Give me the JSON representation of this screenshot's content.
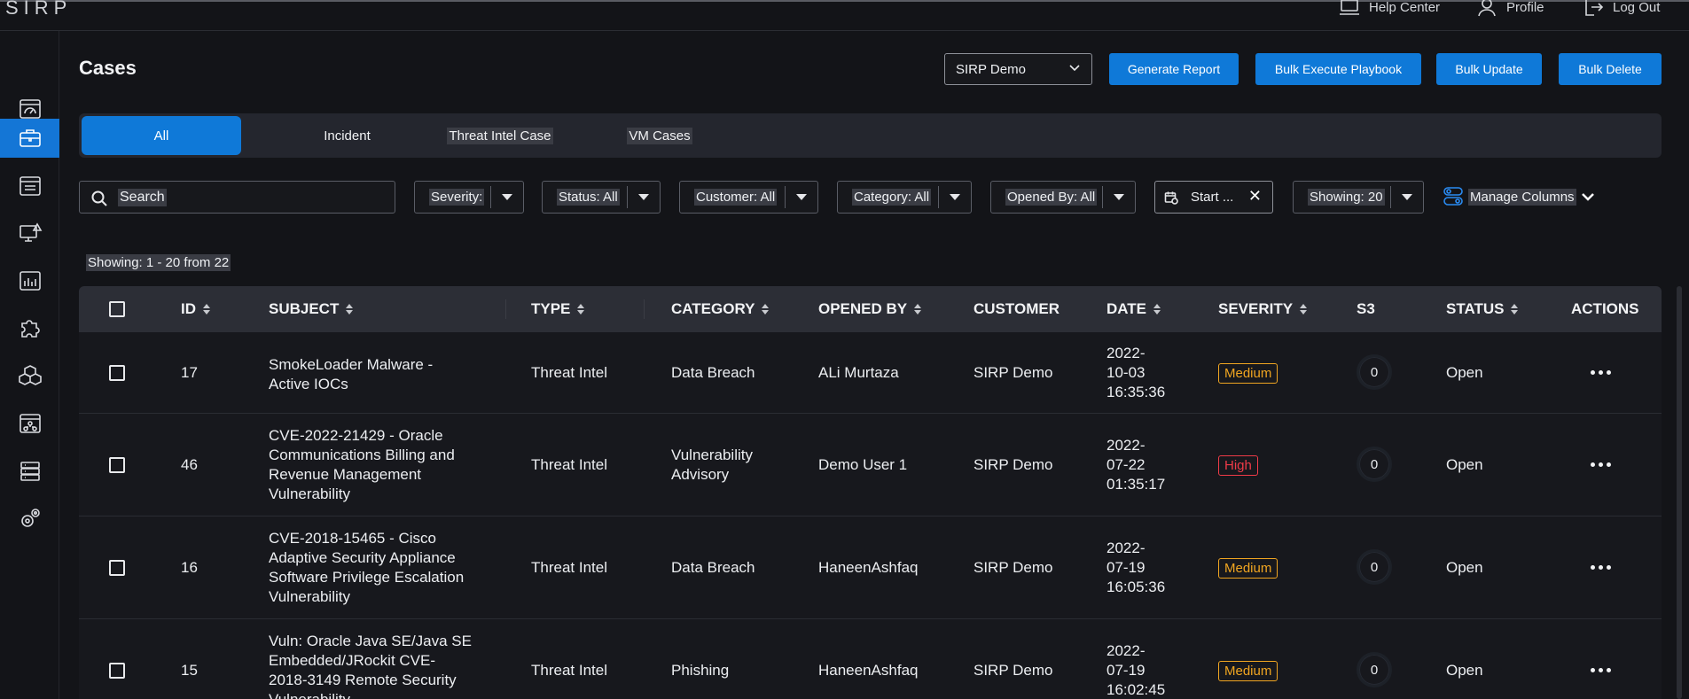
{
  "app": {
    "logo": "SIRP"
  },
  "topbar": {
    "help": "Help Center",
    "profile": "Profile",
    "logout": "Log Out"
  },
  "sidebar": {
    "items": [
      {
        "icon": "dashboard-icon"
      },
      {
        "icon": "briefcase-icon",
        "active": true
      },
      {
        "icon": "list-icon"
      },
      {
        "icon": "monitor-alert-icon"
      },
      {
        "icon": "bar-chart-icon"
      },
      {
        "icon": "puzzle-icon"
      },
      {
        "icon": "cubes-icon"
      },
      {
        "icon": "network-icon"
      },
      {
        "icon": "database-icon"
      },
      {
        "icon": "gears-icon"
      }
    ]
  },
  "page": {
    "title": "Cases"
  },
  "toolbar": {
    "org_select": "SIRP Demo",
    "generate_report": "Generate Report",
    "bulk_execute": "Bulk Execute Playbook",
    "bulk_update": "Bulk Update",
    "bulk_delete": "Bulk Delete"
  },
  "tabs": [
    {
      "label": "All",
      "active": true
    },
    {
      "label": "Incident"
    },
    {
      "label": "Threat Intel Case"
    },
    {
      "label": "VM Cases"
    }
  ],
  "filters": {
    "search_placeholder": "Search",
    "severity": "Severity:",
    "status": "Status: All",
    "customer": "Customer: All",
    "category": "Category: All",
    "opened_by": "Opened By: All",
    "date": "Start ...",
    "showing": "Showing: 20",
    "manage_columns": "Manage Columns"
  },
  "showing_count": "Showing: 1 - 20 from 22",
  "table": {
    "headers": {
      "id": "ID",
      "subject": "SUBJECT",
      "type": "TYPE",
      "category": "CATEGORY",
      "opened_by": "OPENED BY",
      "customer": "CUSTOMER",
      "date": "DATE",
      "severity": "SEVERITY",
      "s3": "S3",
      "status": "STATUS",
      "actions": "ACTIONS"
    },
    "rows": [
      {
        "id": "17",
        "subject": [
          "SmokeLoader Malware -",
          "Active IOCs"
        ],
        "type": "Threat Intel",
        "category": [
          "Data Breach"
        ],
        "opened_by": "ALi Murtaza",
        "customer": "SIRP Demo",
        "date": [
          "2022-",
          "10-03",
          "16:35:36"
        ],
        "severity": "Medium",
        "s3": "0",
        "status": "Open"
      },
      {
        "id": "46",
        "subject": [
          "CVE-2022-21429 - Oracle",
          "Communications Billing and",
          "Revenue Management",
          "Vulnerability"
        ],
        "type": "Threat Intel",
        "category": [
          "Vulnerability",
          "Advisory"
        ],
        "opened_by": "Demo User 1",
        "customer": "SIRP Demo",
        "date": [
          "2022-",
          "07-22",
          "01:35:17"
        ],
        "severity": "High",
        "s3": "0",
        "status": "Open"
      },
      {
        "id": "16",
        "subject": [
          "CVE-2018-15465 - Cisco",
          "Adaptive Security Appliance",
          "Software Privilege Escalation",
          "Vulnerability"
        ],
        "type": "Threat Intel",
        "category": [
          "Data Breach"
        ],
        "opened_by": "HaneenAshfaq",
        "customer": "SIRP Demo",
        "date": [
          "2022-",
          "07-19",
          "16:05:36"
        ],
        "severity": "Medium",
        "s3": "0",
        "status": "Open"
      },
      {
        "id": "15",
        "subject": [
          "Vuln: Oracle Java SE/Java SE",
          "Embedded/JRockit CVE-",
          "2018-3149 Remote Security",
          "Vulnerability"
        ],
        "type": "Threat Intel",
        "category": [
          "Phishing"
        ],
        "opened_by": "HaneenAshfaq",
        "customer": "SIRP Demo",
        "date": [
          "2022-",
          "07-19",
          "16:02:45"
        ],
        "severity": "Medium",
        "s3": "0",
        "status": "Open"
      }
    ]
  }
}
